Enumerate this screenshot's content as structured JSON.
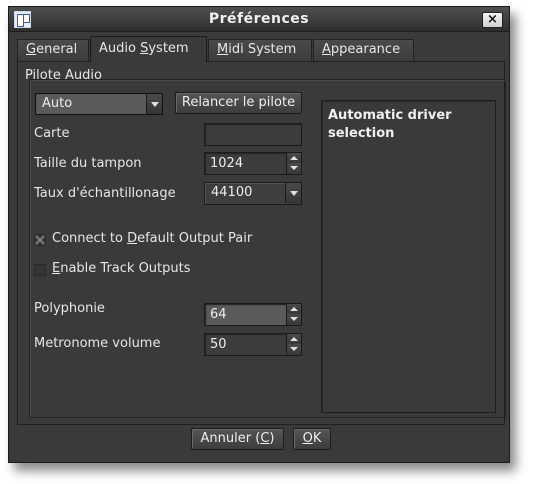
{
  "window": {
    "title": "Préférences",
    "close_glyph": "×"
  },
  "tabs": [
    {
      "key": "G",
      "rest": "eneral",
      "active": false
    },
    {
      "pre": "Audio ",
      "key": "S",
      "rest": "ystem",
      "active": true
    },
    {
      "key": "M",
      "rest": "idi System",
      "active": false
    },
    {
      "key": "A",
      "rest": "ppearance",
      "active": false
    }
  ],
  "audio": {
    "group_title": "Pilote Audio",
    "driver_select": "Auto",
    "restart_button": "Relancer le pilote",
    "card_label": "Carte",
    "card_value": "",
    "buffer_label": "Taille du tampon",
    "buffer_value": "1024",
    "samplerate_label": "Taux d'échantillonage",
    "samplerate_value": "44100",
    "connect_default": {
      "pre": "Connect to ",
      "key": "D",
      "rest": "efault Output Pair",
      "checked": true
    },
    "track_outputs": {
      "key": "E",
      "rest": "nable Track Outputs",
      "checked": false
    },
    "polyphony_label": "Polyphonie",
    "polyphony_value": "64",
    "metronome_label": "Metronome volume",
    "metronome_value": "50",
    "info_text": "Automatic driver selection"
  },
  "footer": {
    "cancel_pre": "Annuler (",
    "cancel_key": "C",
    "cancel_post": ")",
    "ok_key": "O",
    "ok_rest": "K"
  }
}
